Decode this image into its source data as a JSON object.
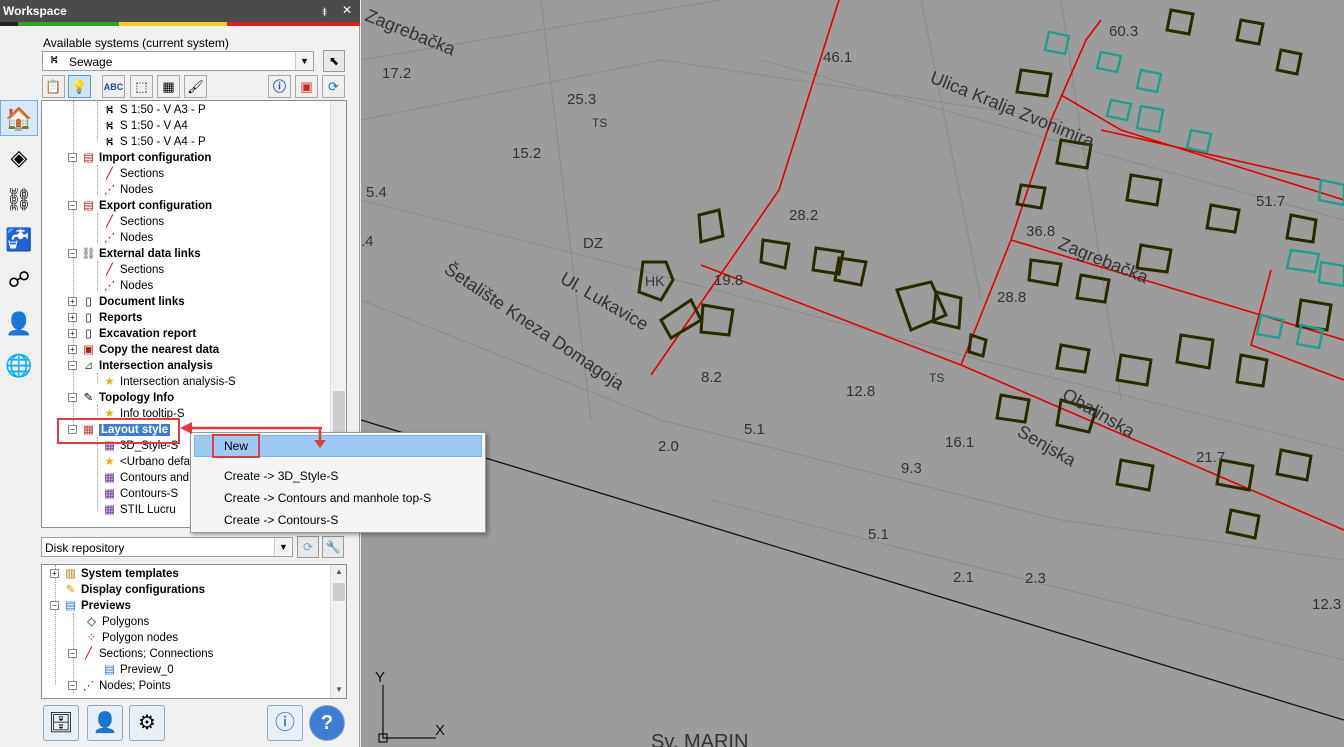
{
  "window": {
    "title": "Workspace",
    "pin_glyph": "⯒",
    "close_glyph": "✕"
  },
  "systems": {
    "label": "Available systems (current system)",
    "selected": "Sewage",
    "icon": "sewage-icon"
  },
  "toolbar": {
    "icons": [
      "properties-icon",
      "bulb-icon",
      "label-abc-icon",
      "select-icon",
      "table-icon",
      "brush-icon",
      "info-icon",
      "layer-add-icon",
      "refresh-icon"
    ]
  },
  "sidebar": {
    "icons": [
      "house-icon",
      "grid-icon",
      "pipe-icon",
      "tap-icon",
      "network-icon",
      "user-icon",
      "globe-icon"
    ]
  },
  "tree": {
    "items": [
      {
        "text": "S 1:50 - V A3 - P",
        "icon": "sewage-icon"
      },
      {
        "text": "S 1:50 - V A4",
        "icon": "sewage-icon"
      },
      {
        "text": "S 1:50 - V A4 - P",
        "icon": "sewage-icon"
      },
      {
        "text": "Import configuration",
        "icon": "import-icon"
      },
      {
        "text": "Sections",
        "icon": "section-icon"
      },
      {
        "text": "Nodes",
        "icon": "node-icon"
      },
      {
        "text": "Export configuration",
        "icon": "export-icon"
      },
      {
        "text": "Sections",
        "icon": "section-icon"
      },
      {
        "text": "Nodes",
        "icon": "node-icon"
      },
      {
        "text": "External data links",
        "icon": "link-icon"
      },
      {
        "text": "Sections",
        "icon": "section-icon"
      },
      {
        "text": "Nodes",
        "icon": "node-icon"
      },
      {
        "text": "Document links",
        "icon": "document-icon"
      },
      {
        "text": "Reports",
        "icon": "report-icon"
      },
      {
        "text": "Excavation report",
        "icon": "excavation-icon"
      },
      {
        "text": "Copy the nearest data",
        "icon": "copy-icon"
      },
      {
        "text": "Intersection analysis",
        "icon": "chart-icon"
      },
      {
        "text": "Intersection analysis-S",
        "icon": "star-icon"
      },
      {
        "text": "Topology Info",
        "icon": "topology-icon"
      },
      {
        "text": "Info tooltip-S",
        "icon": "star-icon"
      },
      {
        "text": "Layout style",
        "icon": "layout-style-icon"
      },
      {
        "text": "3D_Style-S",
        "icon": "layout-style-icon"
      },
      {
        "text": "<Urbano defa",
        "icon": "star-icon"
      },
      {
        "text": "Contours and",
        "icon": "layout-style-icon"
      },
      {
        "text": "Contours-S",
        "icon": "layout-style-icon"
      },
      {
        "text": "STIL Lucru",
        "icon": "layout-style-icon"
      }
    ]
  },
  "context_menu": {
    "items": [
      "New",
      "Create -> 3D_Style-S",
      "Create -> Contours and manhole top-S",
      "Create -> Contours-S"
    ]
  },
  "repository": {
    "selected": "Disk repository"
  },
  "repo_tree": {
    "items": [
      {
        "text": "System templates",
        "icon": "templates-icon"
      },
      {
        "text": "Display configurations",
        "icon": "display-config-icon"
      },
      {
        "text": "Previews",
        "icon": "preview-icon"
      },
      {
        "text": "Polygons",
        "icon": "polygon-icon"
      },
      {
        "text": "Polygon nodes",
        "icon": "polygon-nodes-icon"
      },
      {
        "text": "Sections; Connections",
        "icon": "section-icon"
      },
      {
        "text": "Preview_0",
        "icon": "preview-icon"
      },
      {
        "text": "Nodes; Points",
        "icon": "node-icon"
      }
    ]
  },
  "bottom_buttons": {
    "icons": [
      "database-icon",
      "user-icon",
      "settings-check-icon",
      "info-window-icon",
      "help-icon"
    ],
    "help_glyph": "?"
  },
  "map": {
    "streets": [
      "Zagrebačka",
      "Ulica Kralja Zvonimira",
      "Ul. Lukavice",
      "Šetalište Kneza Domagoja",
      "Zagrebačka",
      "Obalinska",
      "Senjska",
      "Sv. MARIN"
    ],
    "labels": [
      "60.3",
      "17.2",
      "46.1",
      "25.3",
      "TS",
      "15.2",
      "5.4",
      "28.2",
      "51.7",
      "36.8",
      "DZ",
      "HK",
      "19.8",
      "28.8",
      "8.2",
      "12.8",
      "TS",
      "2.0",
      "5.1",
      "16.1",
      "9.3",
      "21.7",
      "5.1",
      "2.1",
      "2.3",
      "12.3",
      ".4"
    ],
    "axis": {
      "y": "Y",
      "x": "X"
    },
    "colors": {
      "background": "#9c9c9c",
      "pipe": "#e00000",
      "building": "#2a2a00",
      "highlight": "#1f9e8e"
    }
  }
}
